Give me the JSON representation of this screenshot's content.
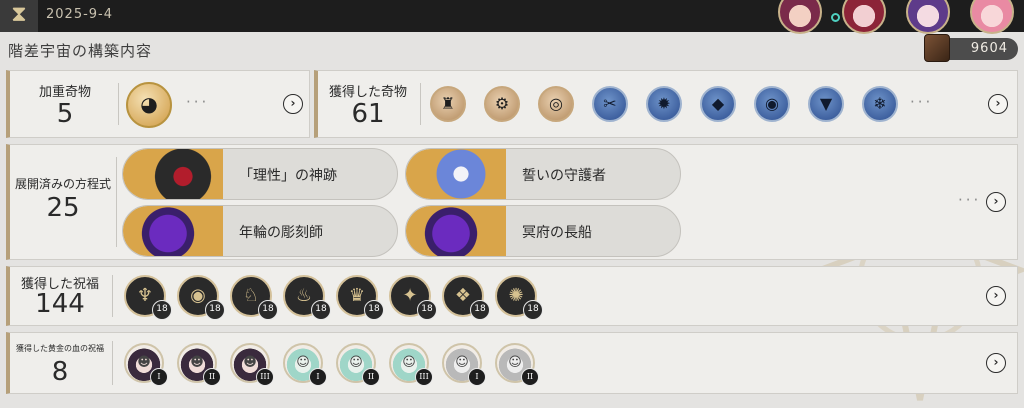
{
  "header": {
    "date": "2025-9-4",
    "logo_glyph": "⧗"
  },
  "avatars": [
    "character-avatar-1",
    "character-avatar-2",
    "character-avatar-3",
    "character-avatar-4"
  ],
  "page_title": "階差宇宙の構築内容",
  "currency": {
    "value": "9604",
    "icon": "cube-icon"
  },
  "weighted_curios": {
    "label": "加重奇物",
    "count": "5",
    "items": [
      {
        "icon": "creature-curio-icon",
        "glyph": "◕"
      }
    ],
    "more": "···"
  },
  "obtained_curios": {
    "label": "獲得した奇物",
    "count": "61",
    "items": [
      {
        "style": "copper",
        "icon": "cloak-curio-icon",
        "glyph": "♜"
      },
      {
        "style": "copper",
        "icon": "robot-curio-icon",
        "glyph": "⚙"
      },
      {
        "style": "copper",
        "icon": "orb-curio-icon",
        "glyph": "◎"
      },
      {
        "style": "blue",
        "icon": "scissors-curio-icon",
        "glyph": "✂"
      },
      {
        "style": "blue",
        "icon": "gear-curio-icon",
        "glyph": "✹"
      },
      {
        "style": "blue",
        "icon": "box-curio-icon",
        "glyph": "◆"
      },
      {
        "style": "blue",
        "icon": "disc-curio-icon",
        "glyph": "◉"
      },
      {
        "style": "blue",
        "icon": "triangle-curio-icon",
        "glyph": "▼"
      },
      {
        "style": "blue",
        "icon": "crystal-curio-icon",
        "glyph": "❄"
      }
    ],
    "more": "···"
  },
  "equations": {
    "label": "展開済みの方程式",
    "count": "25",
    "items": [
      {
        "name": "「理性」の神跡",
        "icon": "miracle-of-reason-icon"
      },
      {
        "name": "誓いの守護者",
        "icon": "oath-guardian-icon"
      },
      {
        "name": "年輪の彫刻師",
        "icon": "tree-ring-sculptor-icon"
      },
      {
        "name": "冥府の長船",
        "icon": "underworld-longship-icon"
      }
    ],
    "more": "···"
  },
  "blessings": {
    "label": "獲得した祝福",
    "count": "144",
    "items": [
      {
        "glyph": "♆",
        "level": "18",
        "icon": "preservation-blessing-icon"
      },
      {
        "glyph": "◉",
        "level": "18",
        "icon": "remembrance-blessing-icon"
      },
      {
        "glyph": "♘",
        "level": "18",
        "icon": "nihility-blessing-icon"
      },
      {
        "glyph": "♨",
        "level": "18",
        "icon": "abundance-blessing-icon"
      },
      {
        "glyph": "♛",
        "level": "18",
        "icon": "hunt-blessing-icon"
      },
      {
        "glyph": "✦",
        "level": "18",
        "icon": "destruction-blessing-icon"
      },
      {
        "glyph": "❖",
        "level": "18",
        "icon": "elation-blessing-icon"
      },
      {
        "glyph": "✺",
        "level": "18",
        "icon": "propagation-blessing-icon"
      }
    ]
  },
  "golden_blood": {
    "label": "獲得した黄金の血の祝福",
    "count": "8",
    "items": [
      {
        "style": "a",
        "glyph": "☻",
        "rank": "I",
        "icon": "golden-blood-blessing-icon"
      },
      {
        "style": "a",
        "glyph": "☻",
        "rank": "II",
        "icon": "golden-blood-blessing-icon"
      },
      {
        "style": "a",
        "glyph": "☻",
        "rank": "III",
        "icon": "golden-blood-blessing-icon"
      },
      {
        "style": "b",
        "glyph": "☺",
        "rank": "I",
        "icon": "golden-blood-blessing-icon"
      },
      {
        "style": "b",
        "glyph": "☺",
        "rank": "II",
        "icon": "golden-blood-blessing-icon"
      },
      {
        "style": "b",
        "glyph": "☺",
        "rank": "III",
        "icon": "golden-blood-blessing-icon"
      },
      {
        "style": "c",
        "glyph": "☺",
        "rank": "I",
        "icon": "golden-blood-blessing-icon"
      },
      {
        "style": "c",
        "glyph": "☺",
        "rank": "II",
        "icon": "golden-blood-blessing-icon"
      }
    ]
  },
  "arrow_glyph": "›"
}
